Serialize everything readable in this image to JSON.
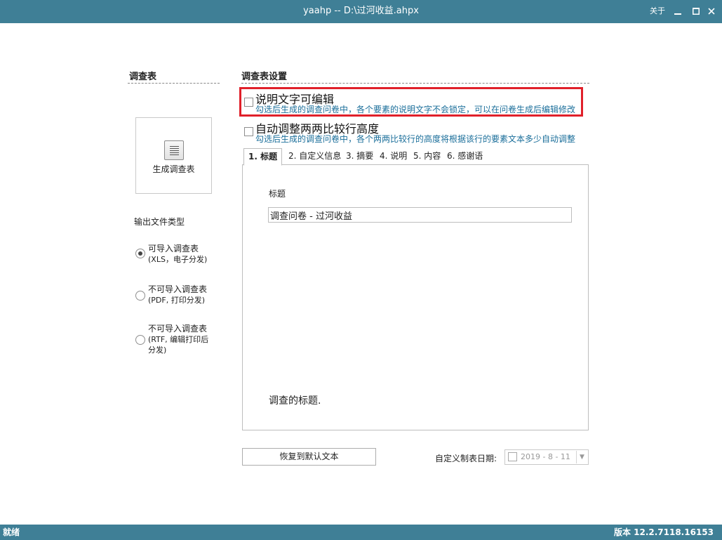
{
  "window": {
    "title": "yaahp -- D:\\过河收益.ahpx",
    "about": "关于",
    "minimize_icon": "minimize-icon",
    "maximize_icon": "maximize-icon",
    "close_icon": "close-icon"
  },
  "left_panel": {
    "section_title": "调查表",
    "generate_button": {
      "label": "生成调查表",
      "icon": "document-list-icon"
    },
    "output_type_label": "输出文件类型",
    "output_options": [
      {
        "label": "可导入调查表",
        "sub": "(XLS，电子分发)",
        "selected": true
      },
      {
        "label": "不可导入调查表",
        "sub": "(PDF, 打印分发)",
        "selected": false
      },
      {
        "label": "不可导入调查表",
        "sub": "(RTF, 编辑打印后",
        "sub2": "分发)",
        "selected": false
      }
    ]
  },
  "settings": {
    "section_title": "调查表设置",
    "options": [
      {
        "label": "说明文字可编辑",
        "desc": "勾选后生成的调查问卷中，各个要素的说明文字不会锁定，可以在问卷生成后编辑修改",
        "checked": false
      },
      {
        "label": "自动调整两两比较行高度",
        "desc": "勾选后生成的调查问卷中，各个两两比较行的高度将根据该行的要素文本多少自动调整",
        "checked": false
      }
    ],
    "tabs": [
      {
        "label": "1.  标题",
        "active": true
      },
      {
        "label": "2. 自定义信息"
      },
      {
        "label": "3. 摘要"
      },
      {
        "label": "4. 说明"
      },
      {
        "label": "5. 内容"
      },
      {
        "label": "6. 感谢语"
      }
    ],
    "panel": {
      "field_label": "标题",
      "field_value": "调查问卷 - 过河收益",
      "description": "调查的标题."
    },
    "restore_button": "恢复到默认文本",
    "date_label": "自定义制表日期:",
    "date_value": "2019 - 8 - 11",
    "date_checked": false
  },
  "status": {
    "left": "就绪",
    "version": "版本 12.2.7118.16153"
  },
  "colors": {
    "titlebar": "#3f7f96",
    "highlight": "#e0202a",
    "description_text": "#1a6e9a"
  }
}
